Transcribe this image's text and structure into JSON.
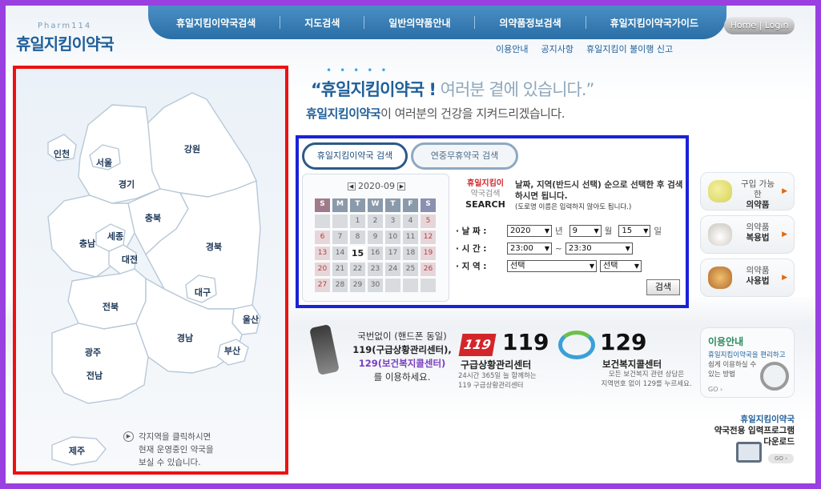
{
  "header": {
    "logo_sub": "Pharm114",
    "logo_main": "휴일지킴이약국",
    "nav": [
      "휴일지킴이약국검색",
      "지도검색",
      "일반의약품안내",
      "의약품정보검색",
      "휴일지킴이약국가이드"
    ],
    "home_login": "Home | Login",
    "subnav": [
      "이용안내",
      "공지사항",
      "휴일지킴이 불이행 신고"
    ]
  },
  "map": {
    "regions": [
      "인천",
      "서울",
      "경기",
      "강원",
      "충북",
      "충남",
      "세종",
      "대전",
      "경북",
      "대구",
      "전북",
      "울산",
      "경남",
      "광주",
      "부산",
      "전남",
      "제주"
    ],
    "note": [
      "각지역을 클릭하시면",
      "현재 운영중인 약국을",
      "보실 수 있습니다."
    ]
  },
  "slogan": {
    "line1_bold": "“휴일지킴이약국 !",
    "line1_rest": "여러분 곁에 있습니다.”",
    "line2_bold": "휴일지킴이약국",
    "line2_rest": "이 여러분의 건강을 지켜드리겠습니다."
  },
  "search": {
    "tabs": [
      "휴일지킴이약국 검색",
      "연중무휴약국 검색"
    ],
    "calendar": {
      "month_label": "2020-09",
      "weekdays": [
        "S",
        "M",
        "T",
        "W",
        "T",
        "F",
        "S"
      ],
      "weeks": [
        [
          "",
          "",
          "1",
          "2",
          "3",
          "4",
          "5"
        ],
        [
          "6",
          "7",
          "8",
          "9",
          "10",
          "11",
          "12"
        ],
        [
          "13",
          "14",
          "15",
          "16",
          "17",
          "18",
          "19"
        ],
        [
          "20",
          "21",
          "22",
          "23",
          "24",
          "25",
          "26"
        ],
        [
          "27",
          "28",
          "29",
          "30",
          "",
          "",
          ""
        ]
      ],
      "today": "15"
    },
    "brand": [
      "휴일지킴이",
      "약국검색",
      "SEARCH"
    ],
    "desc": "날짜, 지역(반드시 선택) 순으로 선택한 후 검색하시면 됩니다.",
    "desc_small": "(도로명 이름은 입력하지 않아도 됩니다.)",
    "date_label": "· 날 짜 :",
    "year": "2020",
    "year_unit": "년",
    "month": "9",
    "month_unit": "월",
    "day": "15",
    "day_unit": "일",
    "time_label": "· 시 간 :",
    "time_from": "23:00",
    "time_sep": "~",
    "time_to": "23:30",
    "region_label": "· 지 역 :",
    "region1": "선택",
    "region2": "선택",
    "search_button": "검색"
  },
  "side_buttons": [
    {
      "line1": "구입 가능한",
      "line2": "의약품"
    },
    {
      "line1": "의약품",
      "line2": "복용법"
    },
    {
      "line1": "의약품",
      "line2": "사용법"
    }
  ],
  "hotlines": {
    "phone": {
      "line1": "국번없이 (핸드폰 동일)",
      "line2": "119(구급상황관리센터),",
      "line3": "129(보건복지콜센터)",
      "line4": "를 이용하세요."
    },
    "h119": {
      "num": "119",
      "title": "구급상황관리센터",
      "desc1": "24시간 365일 늘 함께하는",
      "desc2": "119 구급상황관리센터"
    },
    "h129": {
      "num": "129",
      "title": "보건복지콜센터",
      "desc1": "모든 보건복지 관련 상담은",
      "desc2": "지역번호 없이 129를 누르세요."
    }
  },
  "info": {
    "title": "이용안내",
    "line1": "휴일지킴이약국을 편리하고",
    "line2": "쉽게 이용하실 수",
    "line3": "있는 방법",
    "go": "GO"
  },
  "download": {
    "line1": "휴일지킴이약국",
    "line2": "약국전용 입력프로그램",
    "line3": "다운로드",
    "go": "GO"
  },
  "colors": {
    "accent": "#1f5f99",
    "map_border": "#ee1111",
    "search_border": "#1a22d8"
  }
}
